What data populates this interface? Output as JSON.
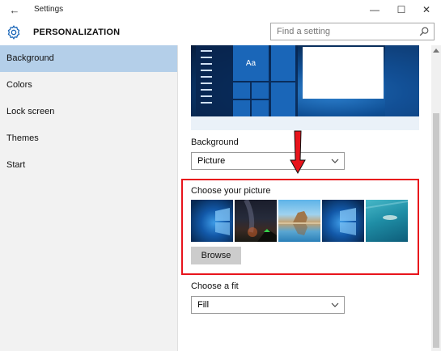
{
  "window": {
    "title": "Settings",
    "back_glyph": "←",
    "min_glyph": "—",
    "max_glyph": "☐",
    "close_glyph": "✕"
  },
  "header": {
    "title": "PERSONALIZATION",
    "icon": "gear-icon",
    "search_placeholder": "Find a setting"
  },
  "sidebar": {
    "items": [
      {
        "label": "Background",
        "selected": true
      },
      {
        "label": "Colors",
        "selected": false
      },
      {
        "label": "Lock screen",
        "selected": false
      },
      {
        "label": "Themes",
        "selected": false
      },
      {
        "label": "Start",
        "selected": false
      }
    ]
  },
  "main": {
    "preview_tile_label": "Aa",
    "background_label": "Background",
    "background_value": "Picture",
    "choose_picture_label": "Choose your picture",
    "browse_label": "Browse",
    "fit_label": "Choose a fit",
    "fit_value": "Fill"
  },
  "colors": {
    "accent": "#1a66b8",
    "selection": "#b4cfe9",
    "annotation": "#e8141c"
  }
}
